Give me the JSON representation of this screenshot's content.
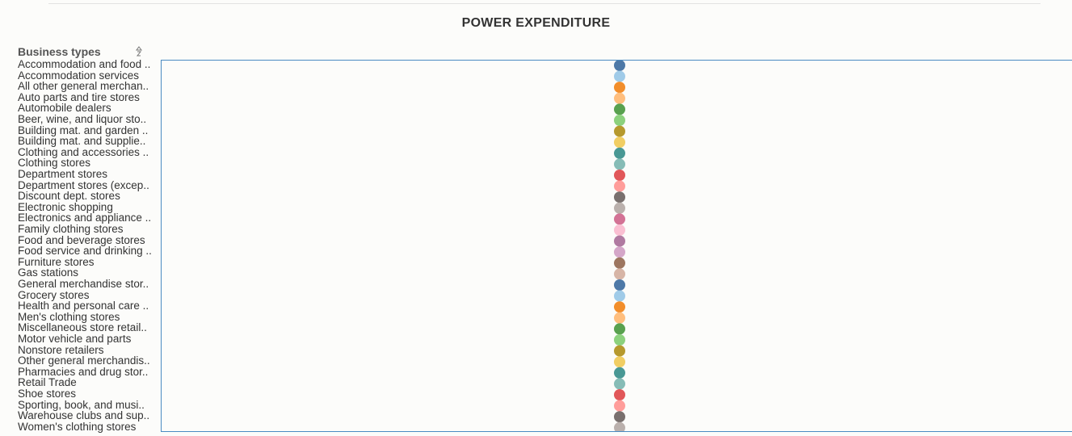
{
  "chart_data": {
    "type": "scatter",
    "title": "POWER EXPENDITURE",
    "row_header": "Business types",
    "sort_icon": "sort-icon",
    "categories": [
      "Accommodation and food ..",
      "Accommodation services",
      "All other general merchan..",
      "Auto parts and tire stores",
      "Automobile dealers",
      "Beer, wine, and liquor sto..",
      "Building mat. and garden ..",
      "Building mat. and supplie..",
      "Clothing and accessories ..",
      "Clothing stores",
      "Department stores",
      "Department stores (excep..",
      "Discount dept. stores",
      "Electronic shopping",
      "Electronics and appliance ..",
      "Family clothing stores",
      "Food and beverage stores",
      "Food service and drinking ..",
      "Furniture stores",
      "Gas stations",
      "General merchandise stor..",
      "Grocery stores",
      "Health and personal care ..",
      "Men's clothing stores",
      "Miscellaneous store retail..",
      "Motor vehicle and parts",
      "Nonstore retailers",
      "Other general merchandis..",
      "Pharmacies and drug stor..",
      "Retail Trade",
      "Shoe stores",
      "Sporting, book, and musi..",
      "Warehouse clubs and sup..",
      "Women's clothing stores"
    ],
    "colors": [
      "#4e79a7",
      "#a0cbe8",
      "#f28e2b",
      "#ffbe7d",
      "#59a14f",
      "#8cd17d",
      "#b6992d",
      "#f1ce63",
      "#499894",
      "#86bcb6",
      "#e15759",
      "#ff9d9a",
      "#79706e",
      "#bab0ac",
      "#d37295",
      "#fabfd2",
      "#b07aa1",
      "#d4a6c8",
      "#9d7660",
      "#d7b5a6",
      "#4e79a7",
      "#a0cbe8",
      "#f28e2b",
      "#ffbe7d",
      "#59a14f",
      "#8cd17d",
      "#b6992d",
      "#f1ce63",
      "#499894",
      "#86bcb6",
      "#e15759",
      "#ff9d9a",
      "#79706e",
      "#bab0ac"
    ],
    "grid": false,
    "legend": "none"
  }
}
